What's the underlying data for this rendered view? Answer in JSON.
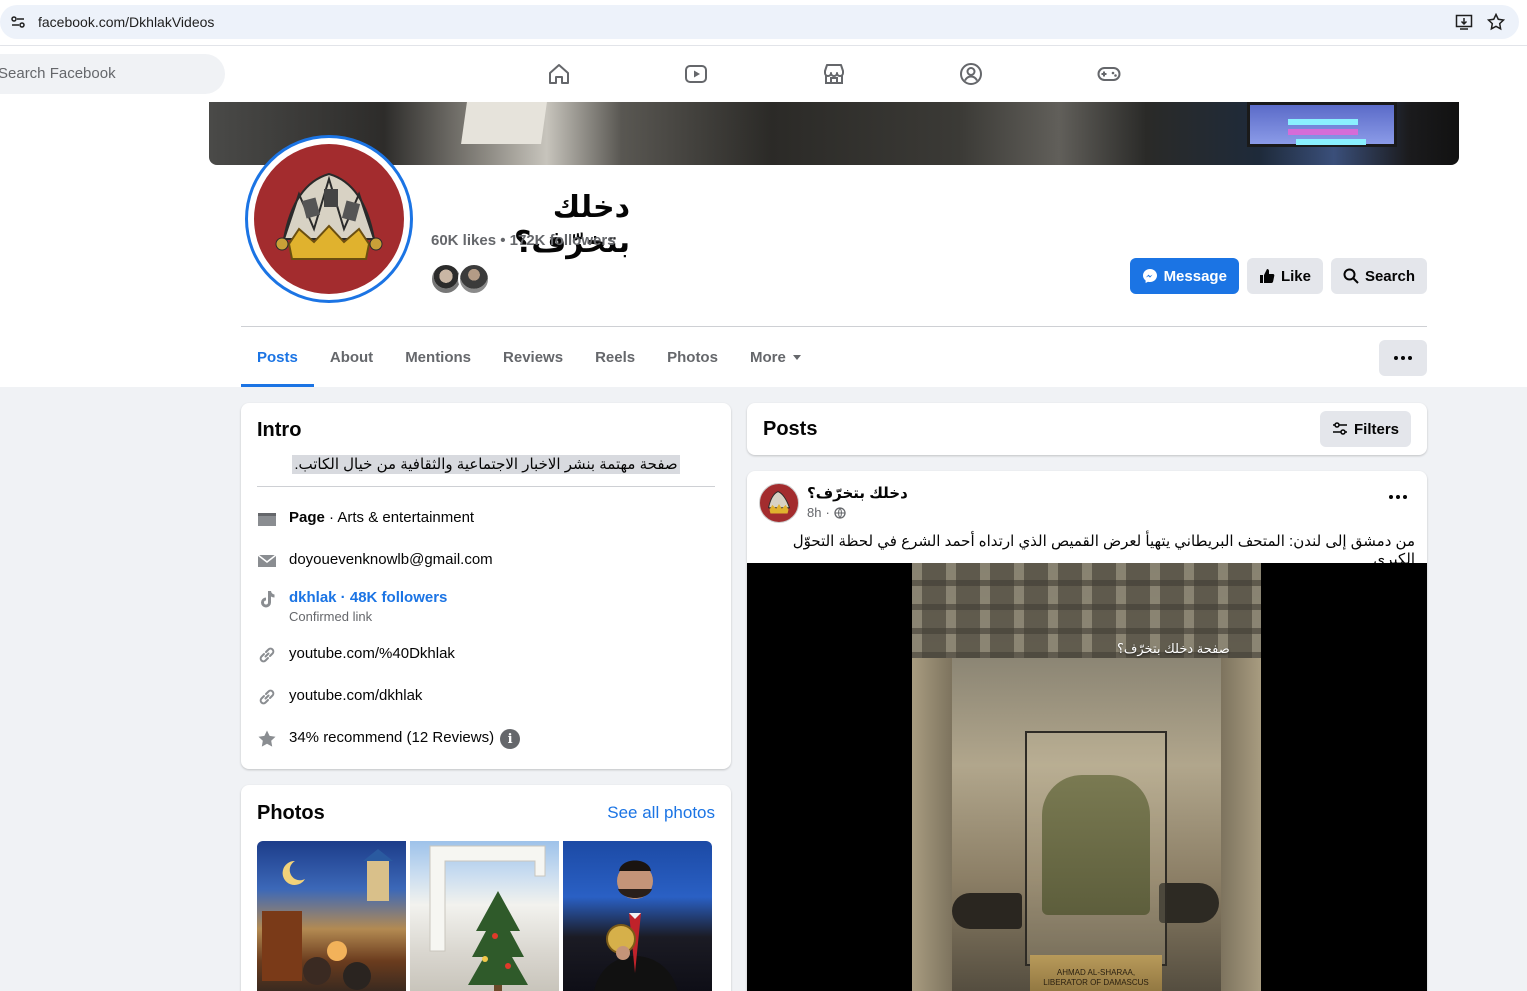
{
  "browser": {
    "url": "facebook.com/DkhlakVideos"
  },
  "fb_nav": {
    "search_placeholder": "Search Facebook",
    "icons": [
      "home-icon",
      "video-icon",
      "marketplace-icon",
      "groups-icon",
      "gaming-icon"
    ]
  },
  "profile": {
    "name": "دخلك بتخرّف؟",
    "stats": "60K likes • 172K followers",
    "actions": {
      "message": "Message",
      "like": "Like",
      "search": "Search"
    }
  },
  "tabs": [
    "Posts",
    "About",
    "Mentions",
    "Reviews",
    "Reels",
    "Photos",
    "More"
  ],
  "active_tab": "Posts",
  "intro": {
    "title": "Intro",
    "bio": "صفحة مهتمة بنشر الاخبار الاجتماعية والثقافية من خيال الكاتب.",
    "category_label": "Page",
    "category_value": " · Arts & entertainment",
    "email": "doyouevenknowlb@gmail.com",
    "tiktok_link": "dkhlak · 48K followers",
    "tiktok_sub": "Confirmed link",
    "link1": "youtube.com/%40Dkhlak",
    "link2": "youtube.com/dkhlak",
    "rating": "34% recommend (12 Reviews)"
  },
  "photos": {
    "title": "Photos",
    "see_all": "See all photos"
  },
  "posts_section": {
    "title": "Posts",
    "filters": "Filters"
  },
  "post": {
    "author": "دخلك بتخرّف؟",
    "time": "8h",
    "text": "من دمشق إلى لندن: المتحف البريطاني يتهيأ لعرض القميص الذي ارتداه أحمد الشرع في لحظة التحوّل الكبرى",
    "image_watermark": "صفحة دخلك بتخرّف؟",
    "plinth_text_1": "AHMAD AL-SHARAA,",
    "plinth_text_2": "LIBERATOR OF DAMASCUS"
  },
  "colors": {
    "brand_blue": "#1b74e4",
    "avatar_red": "#a32c2e"
  }
}
